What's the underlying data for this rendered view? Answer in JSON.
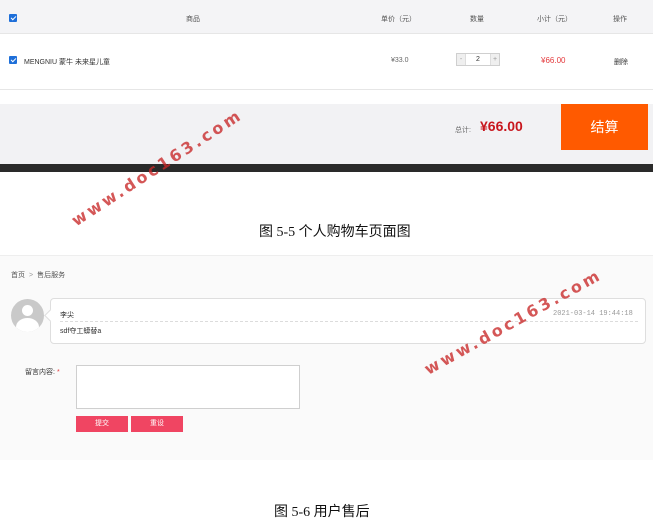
{
  "cart": {
    "headers": {
      "product": "商品",
      "unit_price": "单价（元）",
      "quantity": "数量",
      "subtotal": "小计（元）",
      "action": "操作"
    },
    "items": [
      {
        "name": "MENGNIU 蒙牛 未来星儿童",
        "unit_price": "¥33.0",
        "quantity": "2",
        "subtotal": "¥66.00",
        "action": "删除"
      }
    ],
    "total_label": "总计:",
    "total_amount": "¥66.00",
    "checkout_label": "结算",
    "stepper_minus": "-",
    "stepper_plus": "+"
  },
  "captions": {
    "fig_5_5": "图 5-5 个人购物车页面图",
    "fig_5_6": "图 5-6 用户售后"
  },
  "aftersale": {
    "breadcrumb": {
      "home": "首页",
      "separator": ">",
      "current": "售后服务"
    },
    "comment": {
      "author": "李尖",
      "time": "2021-03-14 19:44:18",
      "text": "sdf夺工蟒替a"
    },
    "form": {
      "label": "留言内容:",
      "required_mark": "*",
      "textarea_value": "",
      "submit_label": "提交",
      "reset_label": "重设"
    }
  },
  "watermark": "www.doc163.com",
  "colors": {
    "accent_orange": "#ff5a00",
    "price_red": "#e4393c",
    "button_pink": "#f04562",
    "checkbox_blue": "#1e6fd9"
  }
}
